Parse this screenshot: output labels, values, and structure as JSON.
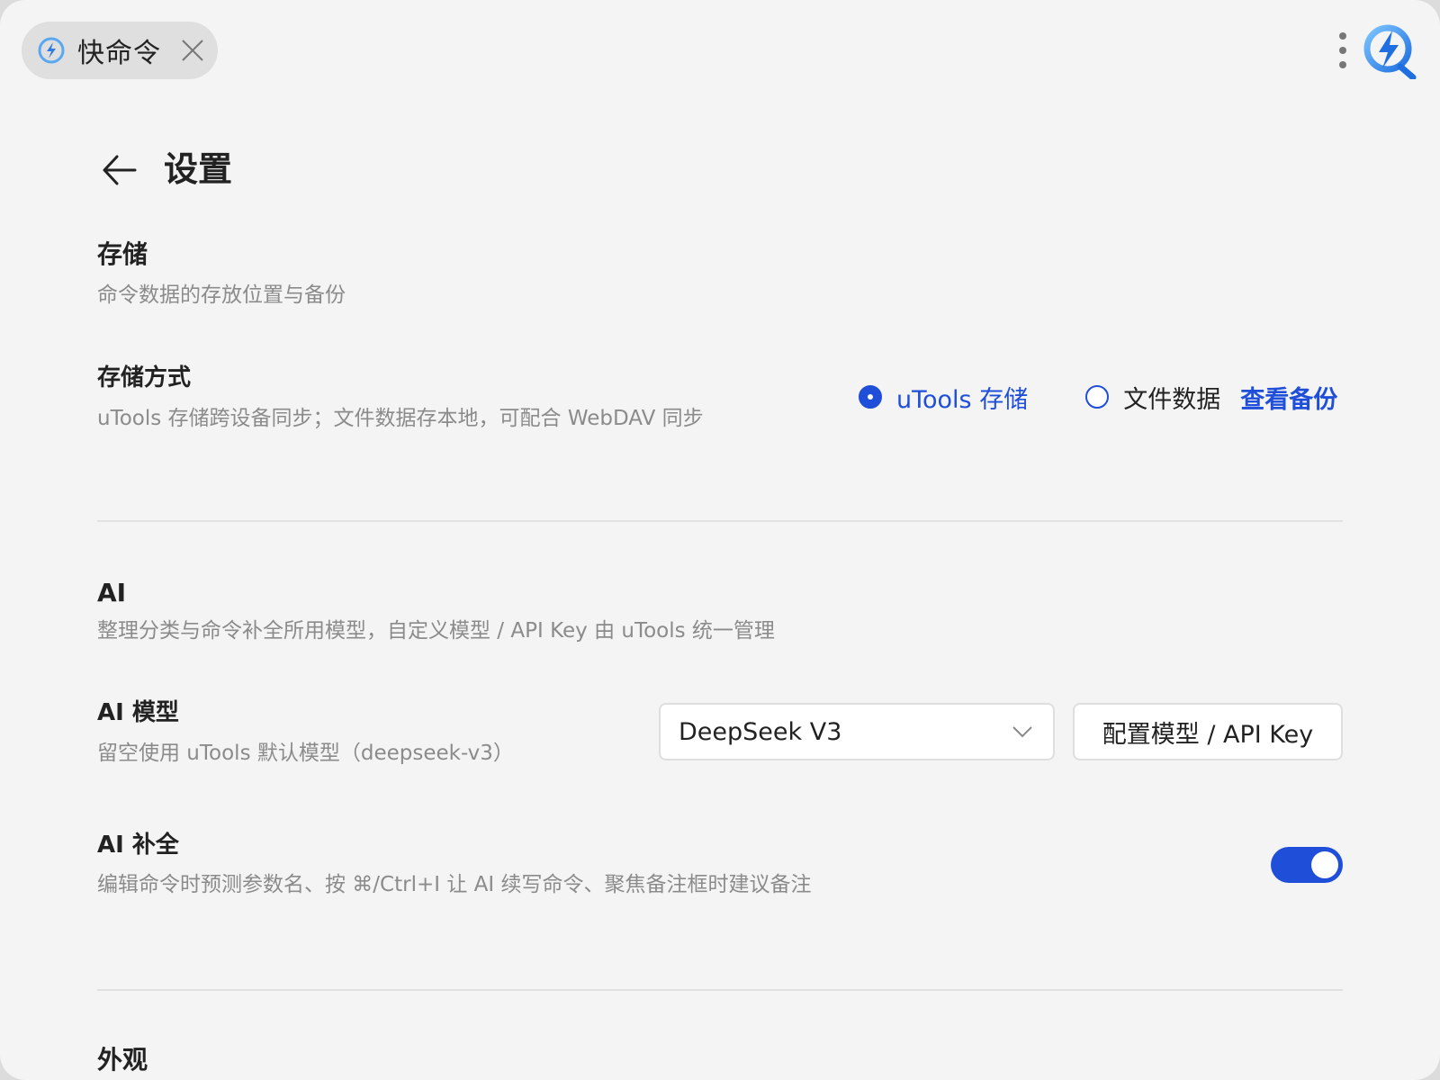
{
  "tab": {
    "label": "快命令",
    "icon": "utools-quick-command-logo"
  },
  "header": {
    "title": "设置",
    "back_icon": "arrow-left-icon"
  },
  "storage": {
    "title": "存储",
    "description": "命令数据的存放位置与备份",
    "mode": {
      "label": "存储方式",
      "description": "uTools 存储跨设备同步；文件数据存本地，可配合 WebDAV 同步",
      "options": [
        {
          "label": "uTools 存储",
          "selected": true
        },
        {
          "label": "文件数据",
          "selected": false
        }
      ],
      "backup_link": "查看备份"
    }
  },
  "ai": {
    "title": "AI",
    "description": "整理分类与命令补全所用模型，自定义模型 / API Key 由 uTools 统一管理",
    "model": {
      "label": "AI 模型",
      "description": "留空使用 uTools 默认模型（deepseek-v3）",
      "selected": "DeepSeek V3",
      "config_button": "配置模型 / API Key"
    },
    "completion": {
      "label": "AI 补全",
      "description": "编辑命令时预测参数名、按 ⌘/Ctrl+I 让 AI 续写命令、聚焦备注框时建议备注",
      "enabled": true
    }
  },
  "next_section": {
    "title": "外观"
  },
  "colors": {
    "accent": "#1f4fd8",
    "background": "#f4f4f4",
    "text": "#222222",
    "muted": "#8b8b8b"
  }
}
